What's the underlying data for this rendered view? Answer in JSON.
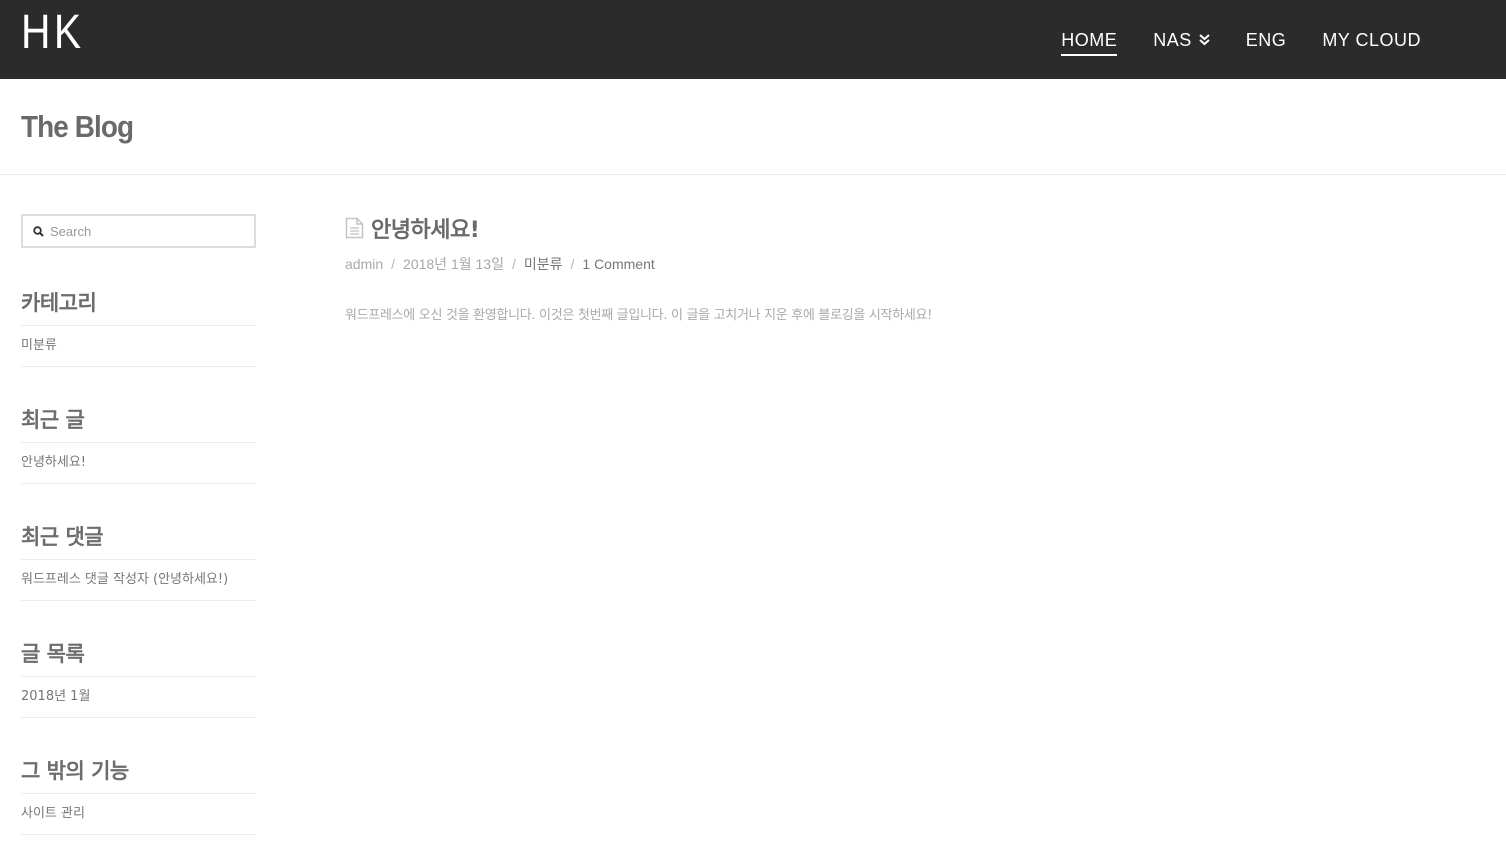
{
  "header": {
    "logo": "HK",
    "nav": [
      {
        "label": "HOME",
        "active": true,
        "dropdown": false
      },
      {
        "label": "NAS",
        "active": false,
        "dropdown": true
      },
      {
        "label": "ENG",
        "active": false,
        "dropdown": false
      },
      {
        "label": "MY CLOUD",
        "active": false,
        "dropdown": false
      }
    ]
  },
  "page": {
    "title": "The Blog"
  },
  "sidebar": {
    "search_placeholder": "Search",
    "widgets": [
      {
        "title": "카테고리",
        "items": [
          "미분류"
        ]
      },
      {
        "title": "최근 글",
        "items": [
          "안녕하세요!"
        ]
      },
      {
        "title": "최근 댓글",
        "items": [
          "워드프레스 댓글 작성자 (안녕하세요!)"
        ]
      },
      {
        "title": "글 목록",
        "items": [
          "2018년 1월"
        ]
      },
      {
        "title": "그 밖의 기능",
        "items": [
          "사이트 관리"
        ]
      }
    ]
  },
  "post": {
    "icon": "document-icon",
    "title": "안녕하세요!",
    "meta": {
      "author": "admin",
      "date": "2018년 1월 13일",
      "category": "미분류",
      "comments": "1 Comment",
      "separator": "/"
    },
    "excerpt": "워드프레스에 오신 것을 환영합니다. 이것은 첫번째 글입니다. 이 글을 고치거나 지운 후에 블로깅을 시작하세요!"
  },
  "colors": {
    "header_bg": "#2b2b2b",
    "header_text": "#ffffff",
    "muted_text": "#a9a9a9",
    "border": "#ececec"
  }
}
